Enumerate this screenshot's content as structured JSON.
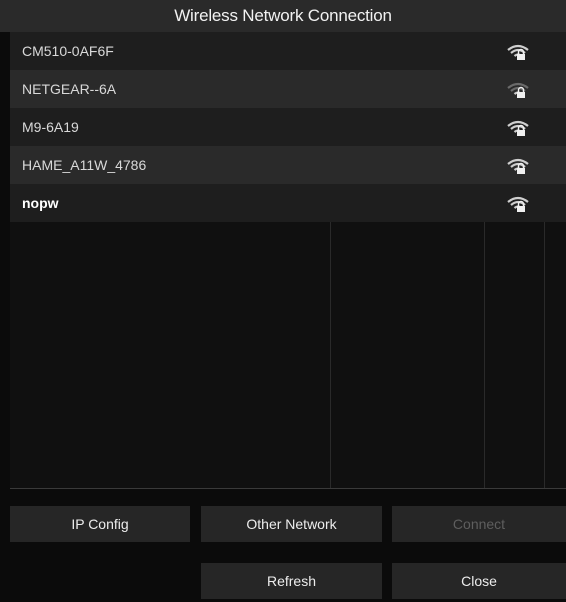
{
  "window": {
    "title": "Wireless Network Connection"
  },
  "networks": [
    {
      "ssid": "CM510-0AF6F",
      "signal_icon": "wifi-lock-icon",
      "bold": false
    },
    {
      "ssid": "NETGEAR--6A",
      "signal_icon": "wifi-lock-icon",
      "bold": false
    },
    {
      "ssid": "M9-6A19",
      "signal_icon": "wifi-lock-icon",
      "bold": false
    },
    {
      "ssid": "HAME_A11W_4786",
      "signal_icon": "wifi-lock-icon",
      "bold": false
    },
    {
      "ssid": "nopw",
      "signal_icon": "wifi-lock-icon",
      "bold": true
    }
  ],
  "buttons": {
    "ip_config": "IP Config",
    "other_network": "Other Network",
    "connect": "Connect",
    "refresh": "Refresh",
    "close": "Close"
  },
  "colors": {
    "background": "#0b0b0b",
    "row_odd": "#1e1e1e",
    "row_even": "#2a2a2a",
    "button": "#262626",
    "disabled_text": "#5e5e5e"
  }
}
